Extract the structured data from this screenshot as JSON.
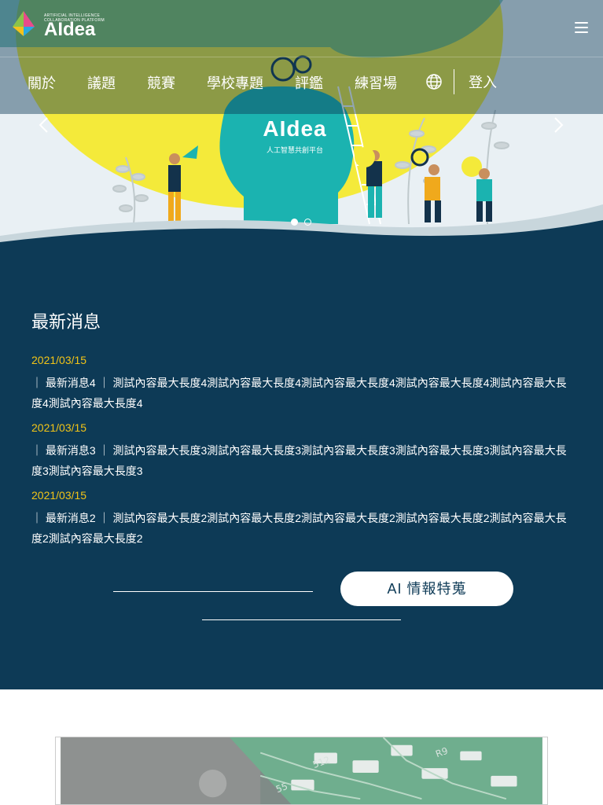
{
  "brand": {
    "logo_small_text": "ARTIFICIAL INTELLIGENCE COLLABORATION PLATFORM",
    "logo_text": "AIdea"
  },
  "hero": {
    "title": "AIdea",
    "subtitle": "人工智慧共創平台",
    "slide_count": 2,
    "active_slide": 1
  },
  "nav": {
    "items": [
      "關於",
      "議題",
      "競賽",
      "學校專題",
      "評鑑",
      "練習場"
    ],
    "login": "登入"
  },
  "news": {
    "heading": "最新消息",
    "items": [
      {
        "date": "2021/03/15",
        "text": "｜ 最新消息4 ｜ 測試內容最大長度4測試內容最大長度4測試內容最大長度4測試內容最大長度4測試內容最大長度4測試內容最大長度4"
      },
      {
        "date": "2021/03/15",
        "text": "｜ 最新消息3 ｜ 測試內容最大長度3測試內容最大長度3測試內容最大長度3測試內容最大長度3測試內容最大長度3測試內容最大長度3"
      },
      {
        "date": "2021/03/15",
        "text": "｜ 最新消息2 ｜ 測試內容最大長度2測試內容最大長度2測試內容最大長度2測試內容最大長度2測試內容最大長度2測試內容最大長度2"
      }
    ]
  },
  "feature": {
    "button_label": "AI 情報特蒐"
  },
  "colors": {
    "navy": "#0d3a56",
    "date_yellow": "#f2c417",
    "teal": "#1bb3b0",
    "hero_yellow": "#f4ea3a"
  },
  "icons": {
    "menu": "hamburger-icon",
    "language": "globe-icon",
    "prev": "chevron-left-icon",
    "next": "chevron-right-icon"
  }
}
